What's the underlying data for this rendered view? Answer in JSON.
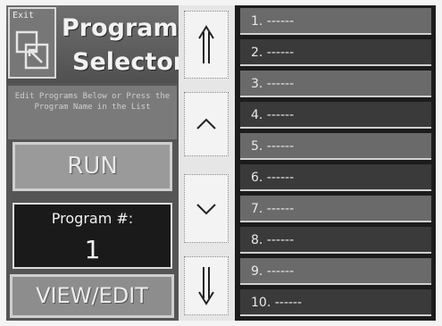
{
  "header": {
    "exit_label": "Exit",
    "title_line1": "Program",
    "title_line2": "Selector"
  },
  "instructions": "Edit Programs Below or Press the Program Name in the List",
  "run_label": "RUN",
  "program_number": {
    "label": "Program #:",
    "value": "1"
  },
  "view_edit_label": "VIEW/EDIT",
  "scroll_icons": [
    "double-arrow-up-icon",
    "chevron-up-icon",
    "chevron-down-icon",
    "double-arrow-down-icon"
  ],
  "programs": [
    {
      "label": "1. ------"
    },
    {
      "label": "2. ------"
    },
    {
      "label": "3. ------"
    },
    {
      "label": "4. ------"
    },
    {
      "label": "5. ------"
    },
    {
      "label": "6. ------"
    },
    {
      "label": "7. ------"
    },
    {
      "label": "8. ------"
    },
    {
      "label": "9. ------"
    },
    {
      "label": "10. ------"
    }
  ]
}
